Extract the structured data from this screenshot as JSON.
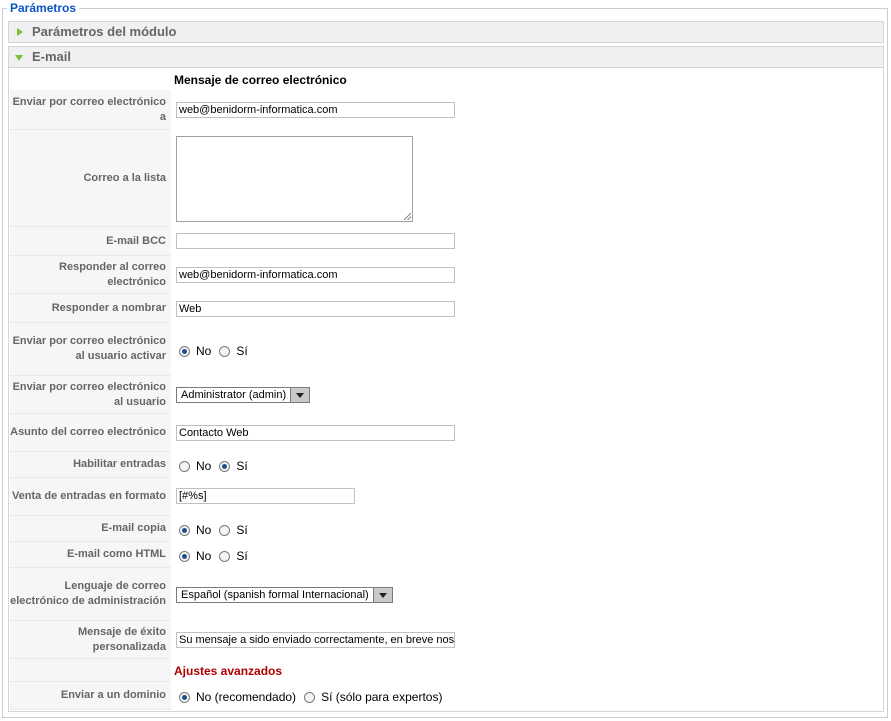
{
  "legend": "Parámetros",
  "panels": {
    "module_params": "Parámetros del módulo",
    "email": "E-mail"
  },
  "section_email_message": "Mensaje de correo electrónico",
  "section_advanced": "Ajustes avanzados",
  "fields": {
    "send_to": {
      "label": "Enviar por correo electrónico a",
      "value": "web@benidorm-informatica.com"
    },
    "mail_list": {
      "label": "Correo a la lista",
      "value": ""
    },
    "bcc": {
      "label": "E-mail BCC",
      "value": ""
    },
    "reply_to": {
      "label": "Responder al correo electrónico",
      "value": "web@benidorm-informatica.com"
    },
    "reply_name": {
      "label": "Responder a nombrar",
      "value": "Web"
    },
    "send_user_activate": {
      "label": "Enviar por correo electrónico al usuario activar",
      "no": "No",
      "yes": "Sí",
      "selected": "No"
    },
    "send_user": {
      "label": "Enviar por correo electrónico al usuario",
      "value": "Administrator (admin)"
    },
    "subject": {
      "label": "Asunto del correo electrónico",
      "value": "Contacto Web"
    },
    "enable_entries": {
      "label": "Habilitar entradas",
      "no": "No",
      "yes": "Sí",
      "selected": "Sí"
    },
    "entries_format": {
      "label": "Venta de entradas en formato",
      "value": "[#%s]"
    },
    "email_copy": {
      "label": "E-mail copia",
      "no": "No",
      "yes": "Sí",
      "selected": "No"
    },
    "email_html": {
      "label": "E-mail como HTML",
      "no": "No",
      "yes": "Sí",
      "selected": "No"
    },
    "admin_language": {
      "label": "Lenguaje de correo electrónico de administración",
      "value": "Español (spanish formal Internacional)"
    },
    "success_message": {
      "label": "Mensaje de éxito personalizada",
      "value": "Su mensaje a sido enviado correctamente, en breve nos"
    },
    "send_domain": {
      "label": "Enviar a un dominio",
      "no": "No (recomendado)",
      "yes": "Sí (sólo para expertos)",
      "selected": "No"
    }
  },
  "colors": {
    "legend": "#0b55c4",
    "advanced": "#b00000",
    "expander": "#7cbf3a"
  }
}
